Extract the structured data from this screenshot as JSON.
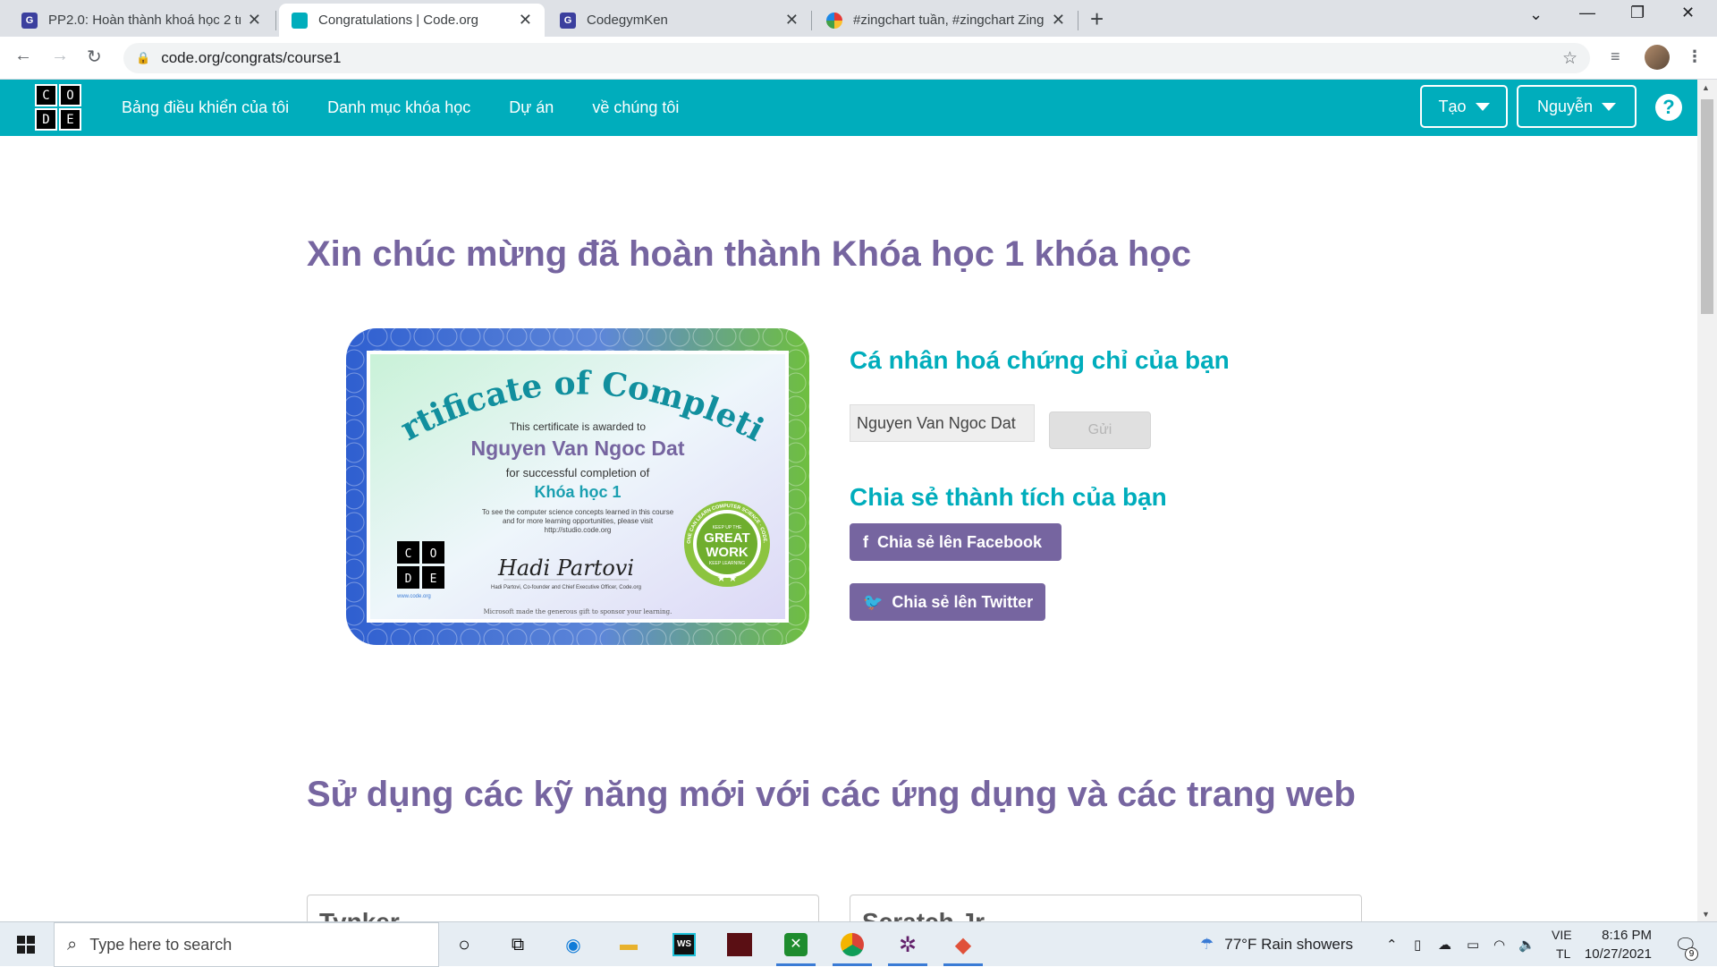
{
  "browser": {
    "tabs": [
      {
        "title": "PP2.0: Hoàn thành khoá học 2 trê",
        "favicon": "codegym-icon",
        "active": false
      },
      {
        "title": "Congratulations | Code.org",
        "favicon": "code-org-icon",
        "active": true
      },
      {
        "title": "CodegymKen",
        "favicon": "codegym-icon",
        "active": false
      },
      {
        "title": "#zingchart tuần, #zingchart Zing",
        "favicon": "zing-icon",
        "active": false
      }
    ],
    "url": "code.org/congrats/course1"
  },
  "header": {
    "logo_letters": [
      "C",
      "O",
      "D",
      "E"
    ],
    "nav": [
      "Bảng điều khiển của tôi",
      "Danh mục khóa học",
      "Dự án",
      "về chúng tôi"
    ],
    "create_label": "Tạo",
    "user_label": "Nguyễn",
    "help_label": "?"
  },
  "main": {
    "title": "Xin chúc mừng đã hoàn thành Khóa học 1 khóa học",
    "certificate": {
      "heading": "Certificate of Completion",
      "awarded_text": "This certificate is awarded to",
      "name": "Nguyen Van Ngoc Dat",
      "completion_text": "for successful completion of",
      "course": "Khóa học 1",
      "info_line1": "To see the computer science concepts learned in this course",
      "info_line2": "and for more learning opportunities, please visit",
      "info_line3": "http://studio.code.org",
      "signature": "Hadi Partovi",
      "signer_title": "Hadi Partovi, Co-founder and Chief Executive Officer, Code.org",
      "site": "www.code.org",
      "badge_top": "KEEP UP THE",
      "badge_line1": "GREAT",
      "badge_line2": "WORK",
      "badge_bottom": "KEEP LEARNING",
      "badge_ring": "ANYONE CAN LEARN COMPUTER SCIENCE · CODE.ORG",
      "sponsor": "Microsoft made the generous gift to sponsor your learning."
    },
    "personalize_title": "Cá nhân hoá chứng chỉ của bạn",
    "name_input_value": "Nguyen Van Ngoc Dat",
    "send_label": "Gửi",
    "share_title": "Chia sẻ thành tích của bạn",
    "facebook_label": "Chia sẻ lên Facebook",
    "twitter_label": "Chia sẻ lên Twitter",
    "apps_title": "Sử dụng các kỹ năng mới với các ứng dụng và các trang web",
    "cards": [
      "Tynker",
      "Scratch Jr"
    ]
  },
  "taskbar": {
    "search_placeholder": "Type here to search",
    "weather": "77°F  Rain showers",
    "lang_top": "VIE",
    "lang_bottom": "TL",
    "time": "8:16 PM",
    "date": "10/27/2021",
    "notification_count": "9"
  }
}
